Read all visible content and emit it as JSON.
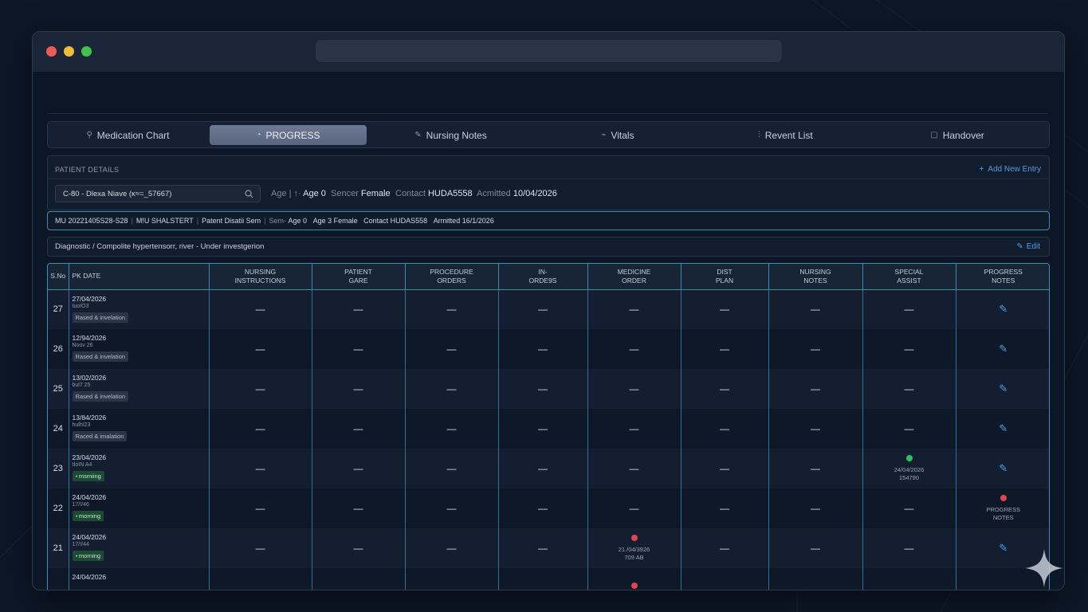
{
  "tabs": [
    {
      "label": "Medication Chart",
      "icon": "pill-icon",
      "glyph": "⚲"
    },
    {
      "label": "PROGRESS",
      "icon": "progress-icon",
      "glyph": "◔"
    },
    {
      "label": "Nursing Notes",
      "icon": "pencil-icon",
      "glyph": "✎"
    },
    {
      "label": "Vitals",
      "icon": "pulse-icon",
      "glyph": "⌁"
    },
    {
      "label": "Revent List",
      "icon": "list-icon",
      "glyph": "⫶"
    },
    {
      "label": "Handover",
      "icon": "handover-icon",
      "glyph": "▢"
    }
  ],
  "patient_details": {
    "label": "PATIENT DETAILS",
    "add_entry": "Add New Entry",
    "selected_patient": "C-80 - Dlexa Niave (ĸ≈=_57667)",
    "age_label": "Age",
    "age_sep": "| ↑·",
    "age_value": "Age 0",
    "sex_label": "Sencer",
    "sex_value": "Female",
    "contact_label": "Contact",
    "contact_value": "HUDA5558",
    "admitted_label": "Acmitted",
    "admitted_value": "10/04/2026"
  },
  "info_bar": {
    "mrn": "MU 20221405S28-S28",
    "ward": "M!U SHALSTERT",
    "status": "Patent Disatii Sem",
    "sem_label": "Sem-",
    "age": "Age 0",
    "age_sex": "Age 3 Female",
    "contact": "Contact HUDAS558",
    "admitted": "Armitted 16/1/2026"
  },
  "diagnosis": {
    "text": "Diagnostic / Compolite hypertensorr, river - Under investgerion",
    "edit_label": "Edit"
  },
  "table": {
    "headers": [
      {
        "l1": "S.No",
        "l2": ""
      },
      {
        "l1": "PK DATE",
        "l2": ""
      },
      {
        "l1": "NURSING",
        "l2": "INSTRUCTIONS"
      },
      {
        "l1": "PATIENT",
        "l2": "GARE"
      },
      {
        "l1": "PROCEDURE",
        "l2": "ORDERS"
      },
      {
        "l1": "IN-",
        "l2": "ORDE9S"
      },
      {
        "l1": "MEDICINE",
        "l2": "ORDER"
      },
      {
        "l1": "DIST",
        "l2": "PLAN"
      },
      {
        "l1": "NURSING",
        "l2": "NOTES"
      },
      {
        "l1": "SPECIAL",
        "l2": "ASSIST"
      },
      {
        "l1": "PROGRESS",
        "l2": "NOTES"
      }
    ],
    "dash": "—",
    "rows": [
      {
        "sno": "27",
        "date": "27/04/2026",
        "sub": "tuoIO3",
        "tag": "Rased & invelation",
        "tag_kind": "grey"
      },
      {
        "sno": "26",
        "date": "12/94/2026",
        "sub": "Noov 26",
        "tag": "Rased & invelation",
        "tag_kind": "grey"
      },
      {
        "sno": "25",
        "date": "13/02/2026",
        "sub": "bul7 25",
        "tag": "Rased & invelation",
        "tag_kind": "grey"
      },
      {
        "sno": "24",
        "date": "13/84/2026",
        "sub": "hulhI23",
        "tag": "Raced & imalation",
        "tag_kind": "grey"
      },
      {
        "sno": "23",
        "date": "23/04/2026",
        "sub": "tIoIN A4",
        "tag": "msmiing",
        "tag_kind": "green",
        "special": {
          "color": "#2fbf5a",
          "l1": "24/04/2026",
          "l2": "154790"
        }
      },
      {
        "sno": "22",
        "date": "24/04/2026",
        "sub": "17/!/46",
        "tag": "morning",
        "tag_kind": "green",
        "progress": {
          "color": "#e0444e",
          "l1": "PROGRESS",
          "l2": "NOTES"
        }
      },
      {
        "sno": "21",
        "date": "24/04/2026",
        "sub": "17/!/44",
        "tag": "morning",
        "tag_kind": "green",
        "medicine": {
          "color": "#e0444e",
          "l1": "21./04/3926",
          "l2": "709 AB"
        }
      },
      {
        "sno": "",
        "date": "24/04/2026",
        "sub": "",
        "tag": "",
        "tag_kind": "none",
        "medicine": {
          "color": "#e0444e",
          "l1": "",
          "l2": ""
        }
      }
    ]
  },
  "colors": {
    "accent": "#4da0e6",
    "table_border": "#3e8fb1",
    "green_status": "#2fbf5a",
    "red_status": "#e0444e"
  }
}
